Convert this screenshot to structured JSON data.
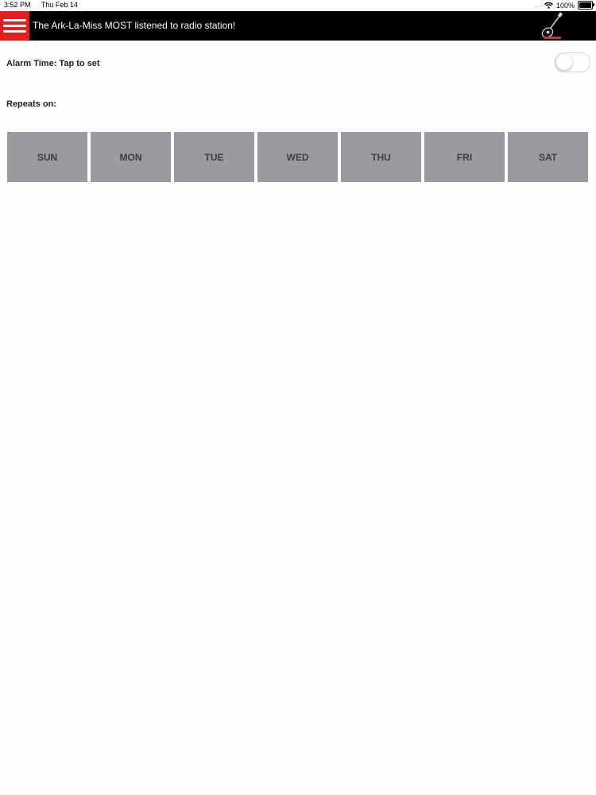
{
  "status_bar": {
    "time": "3:52 PM",
    "date": "Thu Feb 14",
    "signal": "....",
    "battery": "100%"
  },
  "header": {
    "title": "The Ark-La-Miss MOST listened to radio station!",
    "menu_color": "#e41e1e",
    "background": "#000000",
    "logo_icon": "guitar-logo-icon"
  },
  "alarm": {
    "label": "Alarm Time: Tap to set",
    "enabled": false
  },
  "repeats": {
    "label": "Repeats on:",
    "days": [
      "SUN",
      "MON",
      "TUE",
      "WED",
      "THU",
      "FRI",
      "SAT"
    ],
    "day_color": "#9b9a9e"
  }
}
